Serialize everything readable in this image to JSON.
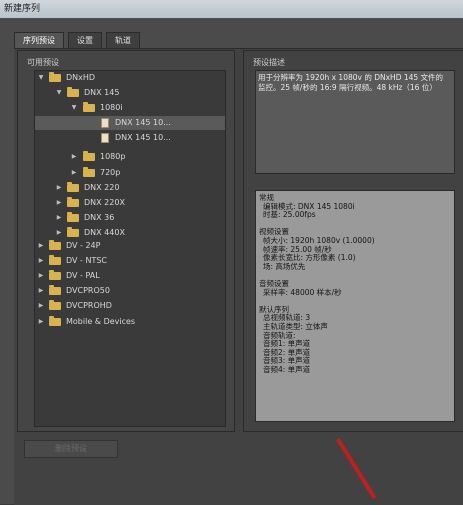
{
  "window": {
    "title": "新建序列"
  },
  "tabs": [
    {
      "label": "序列预设",
      "active": true
    },
    {
      "label": "设置",
      "active": false
    },
    {
      "label": "轨道",
      "active": false
    }
  ],
  "presets": {
    "heading": "可用预设",
    "tree": [
      {
        "label": "DNxHD",
        "expanded": true,
        "type": "folder"
      },
      {
        "label": "DNX 145",
        "expanded": true,
        "type": "folder"
      },
      {
        "label": "1080i",
        "expanded": true,
        "type": "folder"
      },
      {
        "label": "DNX 145 10...",
        "type": "file",
        "selected": true
      },
      {
        "label": "DNX 145 10...",
        "type": "file"
      },
      {
        "label": "1080p",
        "expanded": false,
        "type": "folder"
      },
      {
        "label": "720p",
        "expanded": false,
        "type": "folder"
      },
      {
        "label": "DNX 220",
        "expanded": false,
        "type": "folder"
      },
      {
        "label": "DNX 220X",
        "expanded": false,
        "type": "folder"
      },
      {
        "label": "DNX 36",
        "expanded": false,
        "type": "folder"
      },
      {
        "label": "DNX 440X",
        "expanded": false,
        "type": "folder"
      },
      {
        "label": "DV - 24P",
        "expanded": false,
        "type": "folder"
      },
      {
        "label": "DV - NTSC",
        "expanded": false,
        "type": "folder"
      },
      {
        "label": "DV - PAL",
        "expanded": false,
        "type": "folder"
      },
      {
        "label": "DVCPRO50",
        "expanded": false,
        "type": "folder"
      },
      {
        "label": "DVCPROHD",
        "expanded": false,
        "type": "folder"
      },
      {
        "label": "Mobile & Devices",
        "expanded": false,
        "type": "folder"
      }
    ],
    "delete_button": "删除预设"
  },
  "description": {
    "heading": "预设描述",
    "line1": "用于分辨率为 1920h x 1080v 的 DNxHD 145 文件的",
    "line2": "监控。25 帧/秒的 16:9 隔行视频。48 kHz（16 位）"
  },
  "details": {
    "general_title": "常规",
    "edit_mode": "编辑模式: DNX 145 1080i",
    "timebase": "时基: 25.00fps",
    "video_title": "视频设置",
    "frame_size": "帧大小: 1920h 1080v (1.0000)",
    "frame_rate": "帧速率: 25.00 帧/秒",
    "pixel_aspect": "像素长宽比: 方形像素 (1.0)",
    "fields": "场: 高场优先",
    "audio_title": "音频设置",
    "sample_rate": "采样率: 48000 样本/秒",
    "seq_title": "默认序列",
    "total_video": "总视频轨道: 3",
    "master_track": "主轨道类型: 立体声",
    "audio_tracks": "音频轨道:",
    "audio1": "音频1: 单声道",
    "audio2": "音频2: 单声道",
    "audio3": "音频3: 单声道",
    "audio4": "音频4: 单声道"
  }
}
